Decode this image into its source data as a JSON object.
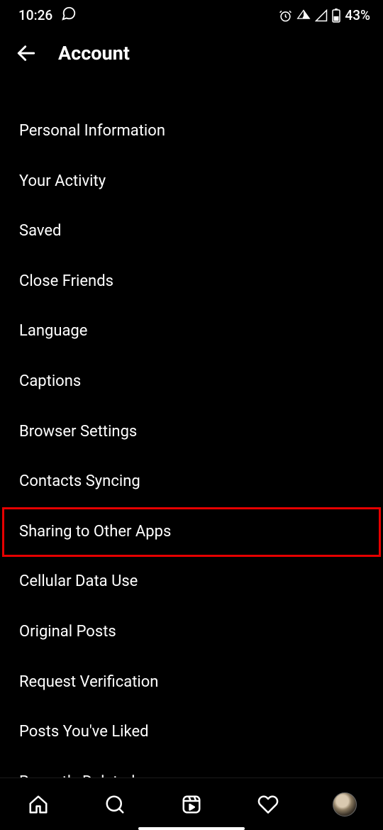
{
  "status": {
    "time": "10:26",
    "battery": "43%"
  },
  "header": {
    "title": "Account"
  },
  "menu": {
    "items": [
      {
        "label": "Personal Information"
      },
      {
        "label": "Your Activity"
      },
      {
        "label": "Saved"
      },
      {
        "label": "Close Friends"
      },
      {
        "label": "Language"
      },
      {
        "label": "Captions"
      },
      {
        "label": "Browser Settings"
      },
      {
        "label": "Contacts Syncing"
      },
      {
        "label": "Sharing to Other Apps",
        "highlighted": true
      },
      {
        "label": "Cellular Data Use"
      },
      {
        "label": "Original Posts"
      },
      {
        "label": "Request Verification"
      },
      {
        "label": "Posts You've Liked"
      },
      {
        "label": "Recently Deleted"
      }
    ]
  }
}
